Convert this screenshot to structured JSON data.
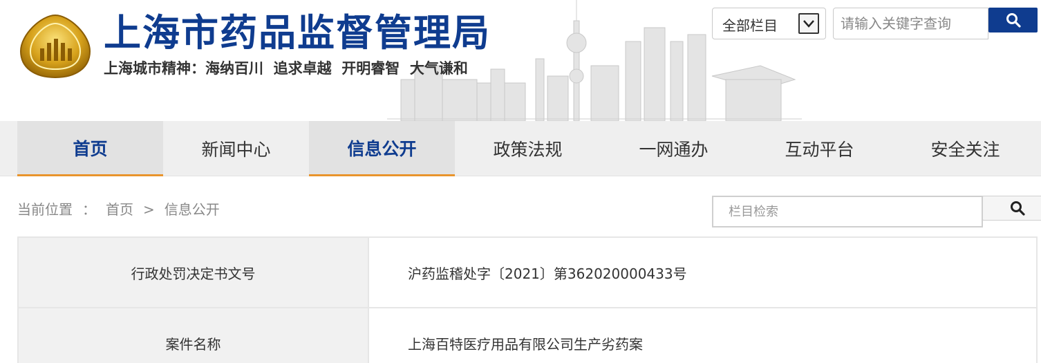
{
  "header": {
    "site_title": "上海市药品监督管理局",
    "slogan": "上海城市精神：海纳百川  追求卓越  开明睿智  大气谦和",
    "scope_select": {
      "selected": "全部栏目"
    },
    "keyword_search": {
      "placeholder": "请输入关键字查询"
    },
    "search_icon": "search-icon",
    "colors": {
      "brand_blue": "#0f3c8f",
      "accent_orange": "#e9942c"
    }
  },
  "nav": {
    "items": [
      {
        "label": "首页",
        "active": true
      },
      {
        "label": "新闻中心",
        "active": false
      },
      {
        "label": "信息公开",
        "active": true
      },
      {
        "label": "政策法规",
        "active": false
      },
      {
        "label": "一网通办",
        "active": false
      },
      {
        "label": "互动平台",
        "active": false
      },
      {
        "label": "安全关注",
        "active": false
      }
    ]
  },
  "breadcrumb": {
    "prefix": "当前位置",
    "colon": "：",
    "items": [
      "首页",
      "信息公开"
    ],
    "separator": ">"
  },
  "column_search": {
    "placeholder": "栏目检索"
  },
  "info_table": {
    "rows": [
      {
        "label": "行政处罚决定书文号",
        "value": "沪药监稽处字〔2021〕第362020000433号"
      },
      {
        "label": "案件名称",
        "value": "上海百特医疗用品有限公司生产劣药案"
      }
    ]
  }
}
